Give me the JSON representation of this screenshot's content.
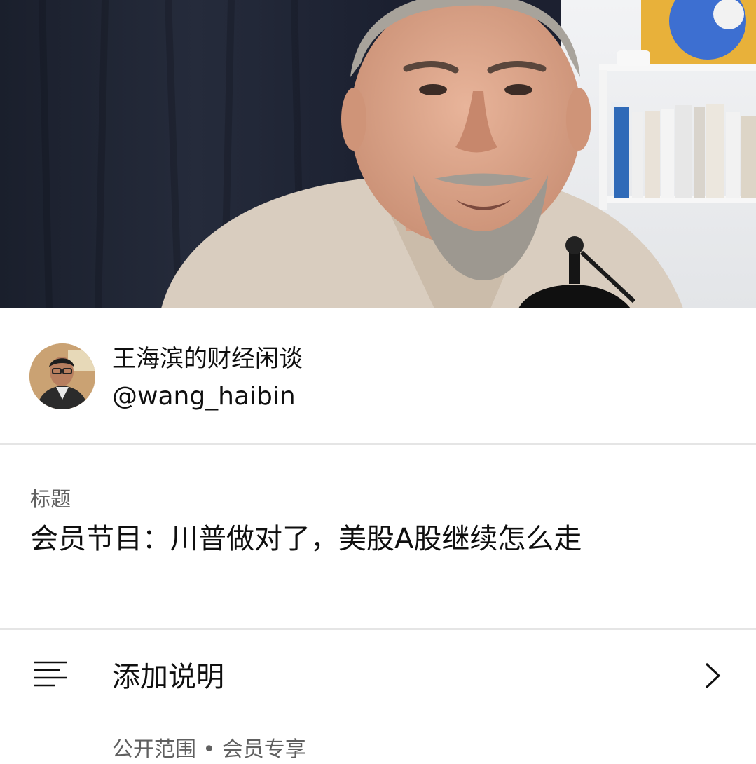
{
  "video": {
    "thumbnail_icon": "video-thumbnail"
  },
  "channel": {
    "avatar_icon": "channel-avatar",
    "name": "王海滨的财经闲谈",
    "handle": "@wang_haibin"
  },
  "title_section": {
    "label": "标题",
    "value": "会员节目：川普做对了，美股A股继续怎么走"
  },
  "description_row": {
    "icon": "description-lines-icon",
    "label": "添加说明",
    "chevron_icon": "chevron-right-icon"
  },
  "visibility_row": {
    "text": "公开范围 • 会员专享"
  },
  "colors": {
    "primary_text": "#0f0f0f",
    "secondary_text": "#606060",
    "divider": "#e5e5e5",
    "background": "#ffffff"
  }
}
